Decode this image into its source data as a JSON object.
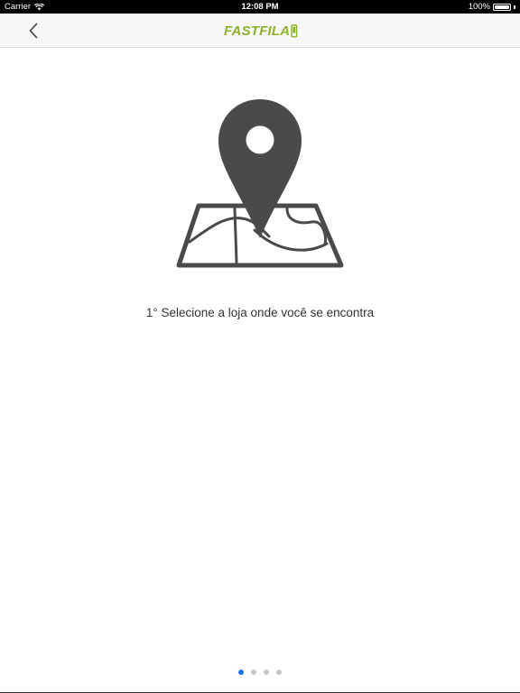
{
  "status_bar": {
    "carrier": "Carrier",
    "time": "12:08 PM",
    "battery_percent": "100%",
    "battery_level": 1.0
  },
  "nav": {
    "back_icon": "chevron-left-icon",
    "logo_text": "FASTFILA",
    "logo_color": "#8cb32a"
  },
  "content": {
    "illustration_icon": "map-pin-on-map-icon",
    "illustration_color": "#4a4a4a",
    "instruction": "1° Selecione a loja onde você se encontra"
  },
  "pager": {
    "count": 4,
    "active_index": 0,
    "active_color": "#1a73e8",
    "inactive_color": "#c7c7c7"
  }
}
